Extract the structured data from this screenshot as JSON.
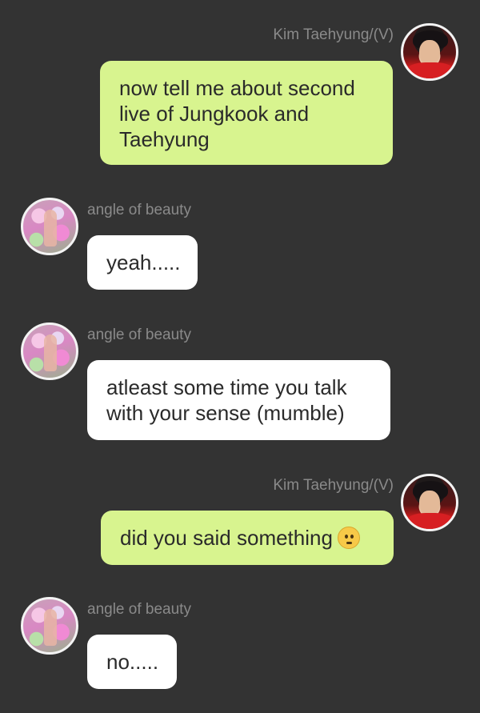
{
  "messages": [
    {
      "sender": "Kim Taehyung/(V)",
      "text": "now tell me about second live of Jungkook and Taehyung"
    },
    {
      "sender": "angle of beauty",
      "text": "yeah....."
    },
    {
      "sender": "angle of beauty",
      "text": "atleast some time you talk with your sense (mumble)"
    },
    {
      "sender": "Kim Taehyung/(V)",
      "text": "did you said something",
      "emoji": "face-with-raised-eyebrow-icon"
    },
    {
      "sender": "angle of beauty",
      "text": "no....."
    }
  ],
  "colors": {
    "background": "#333333",
    "outgoing_bubble": "#d8f48f",
    "incoming_bubble": "#ffffff",
    "sender_name": "#8a8a8a"
  }
}
